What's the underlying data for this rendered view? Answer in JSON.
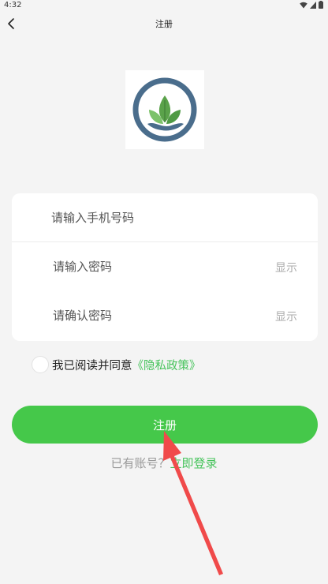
{
  "status_bar": {
    "time": "4:32"
  },
  "nav": {
    "title": "注册"
  },
  "form": {
    "phone_placeholder": "请输入手机号码",
    "password_placeholder": "请输入密码",
    "confirm_placeholder": "请确认密码",
    "show_label": "显示"
  },
  "agreement": {
    "text": "我已阅读并同意",
    "link": "《隐私政策》"
  },
  "register_button": {
    "label": "注册"
  },
  "login": {
    "prompt": "已有账号？",
    "link": "立即登录"
  },
  "colors": {
    "accent": "#45c84a",
    "link": "#45c35a",
    "arrow": "#f04a4a",
    "logo_ring": "#4a6d8c"
  }
}
